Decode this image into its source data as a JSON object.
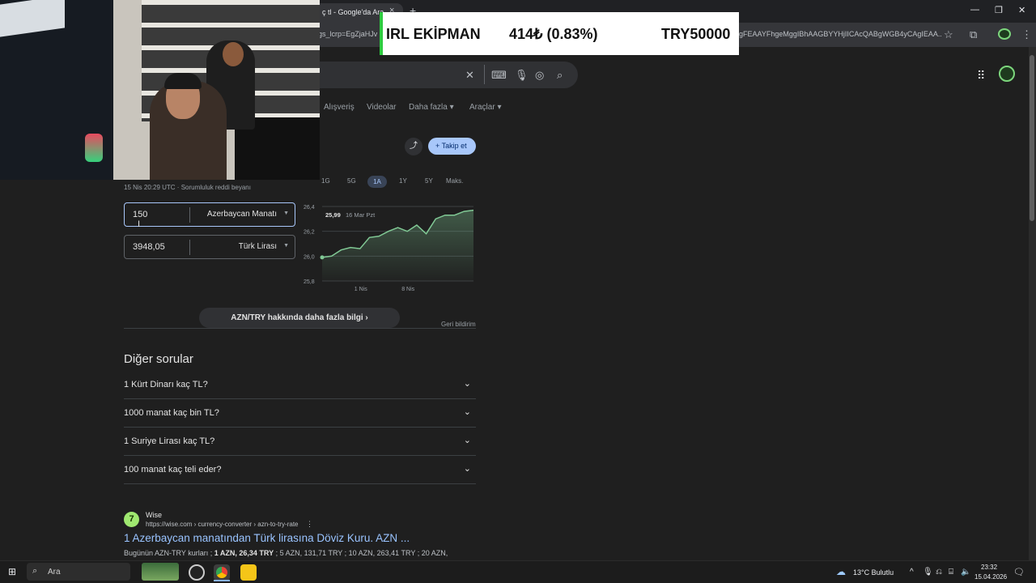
{
  "browser": {
    "tab_title": "ç tl - Google'da Ara",
    "tab_close": "×",
    "new_tab": "+",
    "omnibox_left": "gs_lcrp=EgZjaHJv",
    "omnibox_right": "gFEAAYFhgeMggIBhAAGBYYHjIICAcQABgWGB4yCAgIEAA...",
    "window_min": "—",
    "window_restore": "❐",
    "window_close": "✕"
  },
  "overlay": {
    "name": "IRL EKİPMAN",
    "change": "414₺ (0.83%)",
    "goal": "TRY50000"
  },
  "search": {
    "clear_icon": "✕",
    "nav_tabs": [
      "Alışveriş",
      "Videolar",
      "Daha fazla ▾",
      "Araçlar ▾"
    ]
  },
  "finance": {
    "follow_label": "Takip et",
    "ranges": [
      "1G",
      "5G",
      "1A",
      "1Y",
      "5Y",
      "Maks."
    ],
    "active_range": "1A",
    "updated": "15 Nis 20:29 UTC · Sorumluluk reddi beyanı",
    "converter": {
      "from_value": "150",
      "from_currency": "Azerbaycan Manatı",
      "to_value": "3948,05",
      "to_currency": "Türk Lirası"
    },
    "more_info": "AZN/TRY hakkında daha fazla bilgi",
    "feedback": "Geri bildirim"
  },
  "chart_data": {
    "type": "line",
    "tooltip_value": "25,99",
    "tooltip_date": "16 Mar Pzt",
    "y_ticks": [
      "26,4",
      "26,2",
      "26,0",
      "25,8"
    ],
    "x_ticks": [
      "1 Nis",
      "8 Nis"
    ],
    "ylim": [
      25.8,
      26.4
    ],
    "values": [
      25.99,
      26.0,
      26.05,
      26.07,
      26.06,
      26.15,
      26.16,
      26.2,
      26.23,
      26.2,
      26.25,
      26.18,
      26.3,
      26.33,
      26.33,
      26.36,
      26.37
    ],
    "line_color": "#81c995",
    "grid": true
  },
  "paa": {
    "title": "Diğer sorular",
    "questions": [
      "1 Kürt Dinarı kaç TL?",
      "1000 manat kaç bin TL?",
      "1 Suriye Lirası kaç TL?",
      "100 manat kaç teli eder?"
    ]
  },
  "result": {
    "site_name": "Wise",
    "url": "https://wise.com › currency-converter › azn-to-try-rate",
    "title": "1 Azerbaycan manatından Türk lirasına Döviz Kuru. AZN ...",
    "snippet_prefix": "Bugünün AZN-TRY kurları ; ",
    "snippet_bold": "1 AZN, 26,34 TRY",
    "snippet_rest": " ; 5 AZN, 131,71 TRY ; 10 AZN, 263,41 TRY ; 20 AZN,"
  },
  "taskbar": {
    "search_label": "Ara",
    "weather": "13°C  Bulutlu",
    "time": "23:32",
    "date": "15.04.2026"
  }
}
